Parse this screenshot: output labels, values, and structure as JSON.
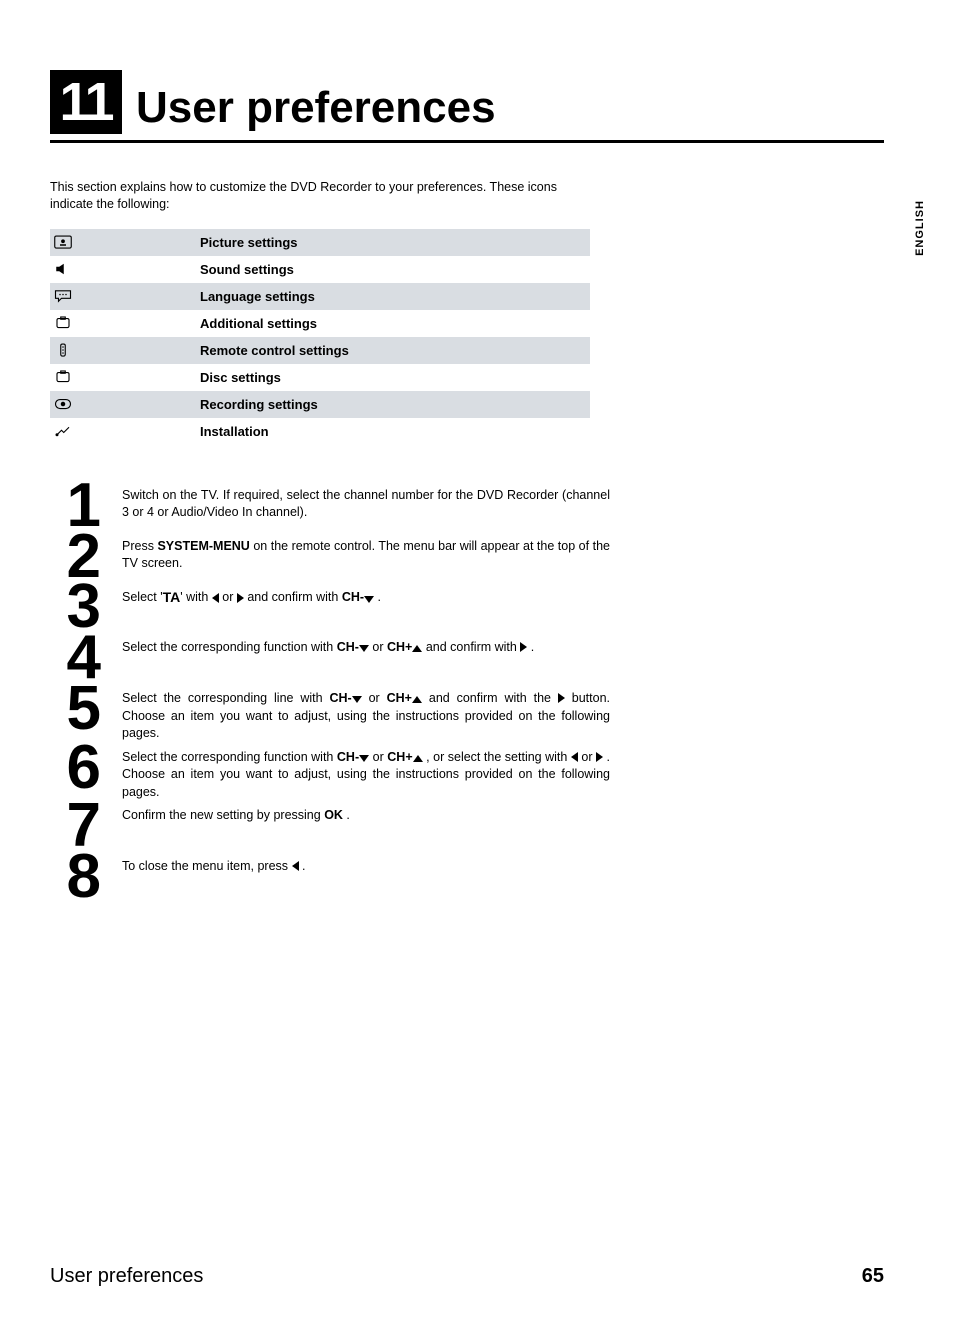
{
  "chapter": {
    "number": "11",
    "title": "User preferences"
  },
  "intro": "This section explains how to customize the DVD Recorder to your preferences. These icons indicate the following:",
  "settings": [
    {
      "label": "Picture settings",
      "shaded": true,
      "icon": "picture-icon"
    },
    {
      "label": "Sound settings",
      "shaded": false,
      "icon": "sound-icon"
    },
    {
      "label": "Language settings",
      "shaded": true,
      "icon": "language-icon"
    },
    {
      "label": "Additional settings",
      "shaded": false,
      "icon": "additional-icon"
    },
    {
      "label": "Remote control settings",
      "shaded": true,
      "icon": "remote-icon"
    },
    {
      "label": "Disc settings",
      "shaded": false,
      "icon": "disc-icon"
    },
    {
      "label": "Recording settings",
      "shaded": true,
      "icon": "recording-icon"
    },
    {
      "label": "Installation",
      "shaded": false,
      "icon": "installation-icon"
    }
  ],
  "steps": [
    {
      "n": "1",
      "segments": [
        {
          "t": "text",
          "v": "Switch on the TV. If required, select the channel number for the DVD Recorder (channel 3 or 4 or Audio/Video In channel)."
        }
      ]
    },
    {
      "n": "2",
      "segments": [
        {
          "t": "text",
          "v": "Press "
        },
        {
          "t": "bold",
          "v": "SYSTEM-MENU"
        },
        {
          "t": "text",
          "v": " on the remote control. The menu bar will appear at the top of the TV screen."
        }
      ]
    },
    {
      "n": "3",
      "segments": [
        {
          "t": "text",
          "v": "Select '"
        },
        {
          "t": "toolicon",
          "v": "TA"
        },
        {
          "t": "text",
          "v": "' with "
        },
        {
          "t": "tri-l"
        },
        {
          "t": "text",
          "v": " or "
        },
        {
          "t": "tri-r"
        },
        {
          "t": "text",
          "v": " and confirm with "
        },
        {
          "t": "bold",
          "v": "CH-"
        },
        {
          "t": "tri-d"
        },
        {
          "t": "text",
          "v": " ."
        }
      ]
    },
    {
      "n": "4",
      "segments": [
        {
          "t": "text",
          "v": "Select the corresponding function with "
        },
        {
          "t": "bold",
          "v": "CH-"
        },
        {
          "t": "tri-d"
        },
        {
          "t": "text",
          "v": " or "
        },
        {
          "t": "bold",
          "v": "CH+"
        },
        {
          "t": "tri-u"
        },
        {
          "t": "text",
          "v": " and confirm with "
        },
        {
          "t": "tri-r"
        },
        {
          "t": "text",
          "v": " ."
        }
      ]
    },
    {
      "n": "5",
      "segments": [
        {
          "t": "text",
          "v": "Select the corresponding line with "
        },
        {
          "t": "bold",
          "v": "CH-"
        },
        {
          "t": "tri-d"
        },
        {
          "t": "text",
          "v": " or "
        },
        {
          "t": "bold",
          "v": "CH+"
        },
        {
          "t": "tri-u"
        },
        {
          "t": "text",
          "v": " and confirm with the "
        },
        {
          "t": "tri-r"
        },
        {
          "t": "text",
          "v": " button. Choose an item you want to adjust, using the instructions provided on the following pages."
        }
      ]
    },
    {
      "n": "6",
      "segments": [
        {
          "t": "text",
          "v": "Select the corresponding function with "
        },
        {
          "t": "bold",
          "v": "CH-"
        },
        {
          "t": "tri-d"
        },
        {
          "t": "text",
          "v": " or "
        },
        {
          "t": "bold",
          "v": "CH+"
        },
        {
          "t": "tri-u"
        },
        {
          "t": "text",
          "v": " , or select the setting with "
        },
        {
          "t": "tri-l"
        },
        {
          "t": "text",
          "v": " or "
        },
        {
          "t": "tri-r"
        },
        {
          "t": "text",
          "v": " . Choose an item you want to adjust, using the instructions provided on the following pages."
        }
      ]
    },
    {
      "n": "7",
      "segments": [
        {
          "t": "text",
          "v": "Confirm the new setting by pressing "
        },
        {
          "t": "bold",
          "v": "OK"
        },
        {
          "t": "text",
          "v": " ."
        }
      ]
    },
    {
      "n": "8",
      "segments": [
        {
          "t": "text",
          "v": "To close the menu item, press "
        },
        {
          "t": "tri-l"
        },
        {
          "t": "text",
          "v": " ."
        }
      ]
    }
  ],
  "language_tab": "ENGLISH",
  "footer": {
    "title": "User preferences",
    "page": "65"
  }
}
